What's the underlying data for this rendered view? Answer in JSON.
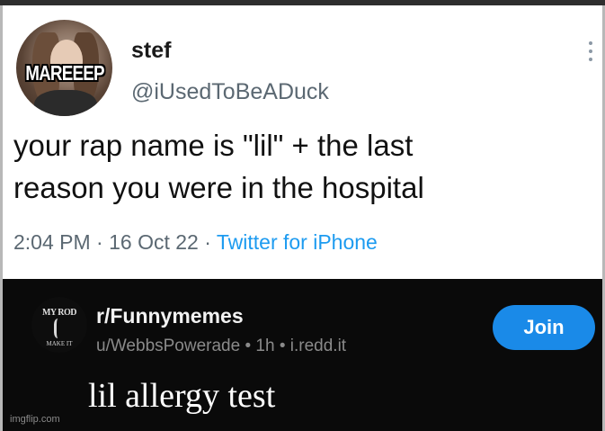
{
  "tweet": {
    "avatar_caption": "MAREEEP",
    "display_name": "stef",
    "handle": "@iUsedToBeADuck",
    "text_line_1": "your rap name is \"lil\" + the last",
    "text_line_2": "reason you were in the hospital",
    "time": "2:04 PM",
    "date": "16 Oct 22",
    "source": "Twitter for iPhone",
    "more_icon": "more-vertical-icon"
  },
  "reddit": {
    "sub_icon_top_text": "MY ROD",
    "sub_icon_bottom_text": "MAKE IT",
    "subreddit": "r/Funnymemes",
    "user": "u/WebbsPowerade",
    "age": "1h",
    "domain": "i.redd.it",
    "join_label": "Join",
    "caption": "lil allergy test"
  },
  "watermark": "imgflip.com",
  "colors": {
    "tweet_bg": "#ffffff",
    "link_blue": "#1d9bf0",
    "reddit_bg": "#0a0a0a",
    "join_blue": "#1a8ae8"
  }
}
